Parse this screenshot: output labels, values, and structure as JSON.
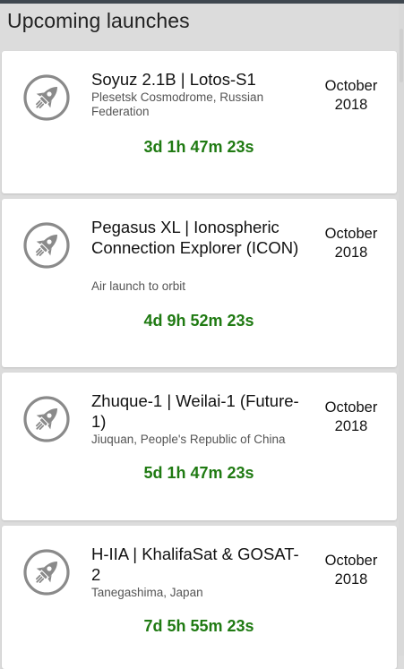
{
  "header": {
    "title": "Upcoming launches"
  },
  "launches": [
    {
      "title": "Soyuz 2.1B | Lotos-S1",
      "location": "Plesetsk Cosmodrome, Russian Federation",
      "date": "October 2018",
      "countdown": "3d 1h 47m 23s",
      "icon": "rocket-icon"
    },
    {
      "title": "Pegasus XL | Ionospheric Connection Explorer (ICON)",
      "location": "Air launch to orbit",
      "date": "October 2018",
      "countdown": "4d 9h 52m 23s",
      "icon": "rocket-icon"
    },
    {
      "title": "Zhuque-1 | Weilai-1 (Future-1)",
      "location": "Jiuquan, People's Republic of China",
      "date": "October 2018",
      "countdown": "5d 1h 47m 23s",
      "icon": "rocket-icon"
    },
    {
      "title": "H-IIA | KhalifaSat & GOSAT-2",
      "location": "Tanegashima, Japan",
      "date": "October 2018",
      "countdown": "7d 5h 55m 23s",
      "icon": "rocket-icon"
    }
  ],
  "colors": {
    "countdown": "#1f7a12",
    "icon": "#8a8a8a",
    "background": "#dcdcdc"
  }
}
